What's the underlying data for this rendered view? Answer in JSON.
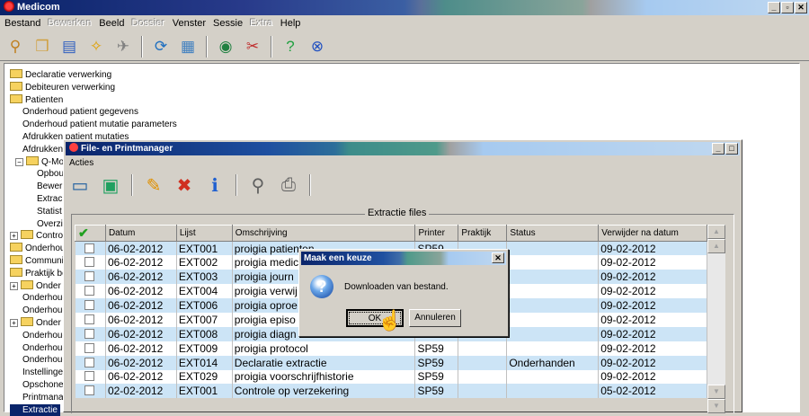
{
  "app": {
    "title": "Medicom"
  },
  "menu": [
    "Bestand",
    "Bewerken",
    "Beeld",
    "Dossier",
    "Venster",
    "Sessie",
    "Extra",
    "Help"
  ],
  "menu_disabled": [
    "Bewerken",
    "Dossier",
    "Extra"
  ],
  "toolbar_icons": [
    "pin-icon",
    "patients-icon",
    "documents-icon",
    "drug-icon",
    "cart-icon",
    "refresh-icon",
    "calendar-icon",
    "money-icon",
    "tools-icon",
    "help-icon",
    "exit-icon"
  ],
  "tree": [
    "Declaratie verwerking",
    "Debiteuren verwerking",
    "Patienten",
    "Onderhoud patient gegevens",
    "Onderhoud patient mutatie parameters",
    "Afdrukken patient mutaties",
    "Afdrukken",
    "Q-Mod",
    "Opbou",
    "Bewer",
    "Extrac",
    "Statist",
    "Overzi",
    "Contro",
    "Onderhouc",
    "Communica",
    "Praktijk be",
    "Onder",
    "Onderhouc",
    "Onderhouc",
    "Onder",
    "Onderhouc",
    "Onderhouc",
    "Onderhouc",
    "Instellinge",
    "Opschoner",
    "Printmanag",
    "Extractie"
  ],
  "filemanager": {
    "title": "File- en Printmanager",
    "menu": "Acties",
    "group_label": "Extractie files",
    "columns": [
      "Datum",
      "Lijst",
      "Omschrijving",
      "Printer",
      "Praktijk",
      "Status",
      "Verwijder na datum"
    ],
    "rows": [
      [
        "06-02-2012",
        "EXT001",
        "proigia patienten",
        "SP59",
        "",
        "",
        "09-02-2012"
      ],
      [
        "06-02-2012",
        "EXT002",
        "proigia medic",
        "",
        "",
        "",
        "09-02-2012"
      ],
      [
        "06-02-2012",
        "EXT003",
        "proigia journ",
        "",
        "",
        "",
        "09-02-2012"
      ],
      [
        "06-02-2012",
        "EXT004",
        "proigia verwij",
        "",
        "",
        "",
        "09-02-2012"
      ],
      [
        "06-02-2012",
        "EXT006",
        "proigia oproe",
        "",
        "",
        "",
        "09-02-2012"
      ],
      [
        "06-02-2012",
        "EXT007",
        "proigia episo",
        "",
        "",
        "",
        "09-02-2012"
      ],
      [
        "06-02-2012",
        "EXT008",
        "proigia diagn",
        "",
        "",
        "",
        "09-02-2012"
      ],
      [
        "06-02-2012",
        "EXT009",
        "proigia protocol",
        "SP59",
        "",
        "",
        "09-02-2012"
      ],
      [
        "06-02-2012",
        "EXT014",
        "Declaratie extractie",
        "SP59",
        "",
        "Onderhanden",
        "09-02-2012"
      ],
      [
        "06-02-2012",
        "EXT029",
        "proigia voorschrijfhistorie",
        "SP59",
        "",
        "",
        "09-02-2012"
      ],
      [
        "02-02-2012",
        "EXT001",
        "Controle op verzekering",
        "SP59",
        "",
        "",
        "05-02-2012"
      ]
    ]
  },
  "dialog": {
    "title": "Maak een keuze",
    "message": "Downloaden van bestand.",
    "ok": "OK",
    "cancel": "Annuleren"
  }
}
